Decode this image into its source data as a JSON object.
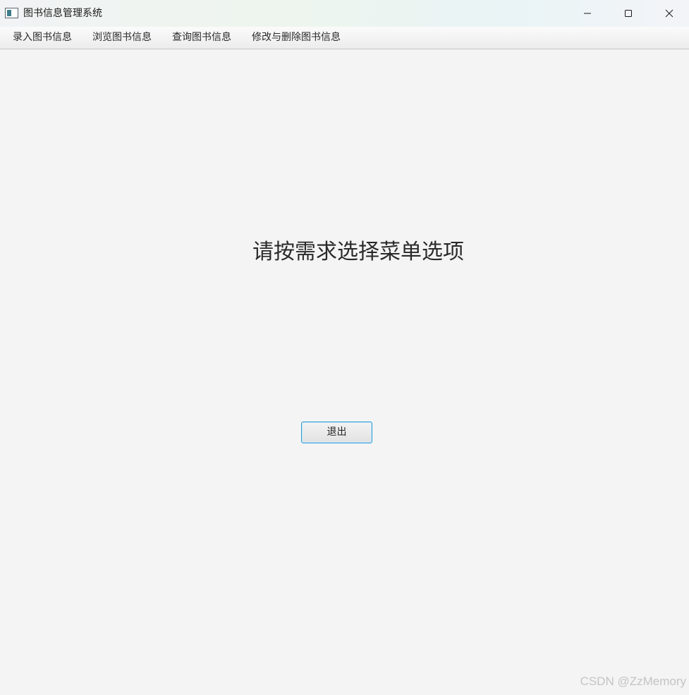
{
  "window": {
    "title": "图书信息管理系统"
  },
  "menu": {
    "items": [
      {
        "label": "录入图书信息"
      },
      {
        "label": "浏览图书信息"
      },
      {
        "label": "查询图书信息"
      },
      {
        "label": "修改与删除图书信息"
      }
    ]
  },
  "main": {
    "prompt": "请按需求选择菜单选项",
    "exit_label": "退出"
  },
  "watermark": "CSDN @ZzMemory",
  "colors": {
    "accent_border": "#2d9bd8",
    "background": "#f4f4f4"
  }
}
